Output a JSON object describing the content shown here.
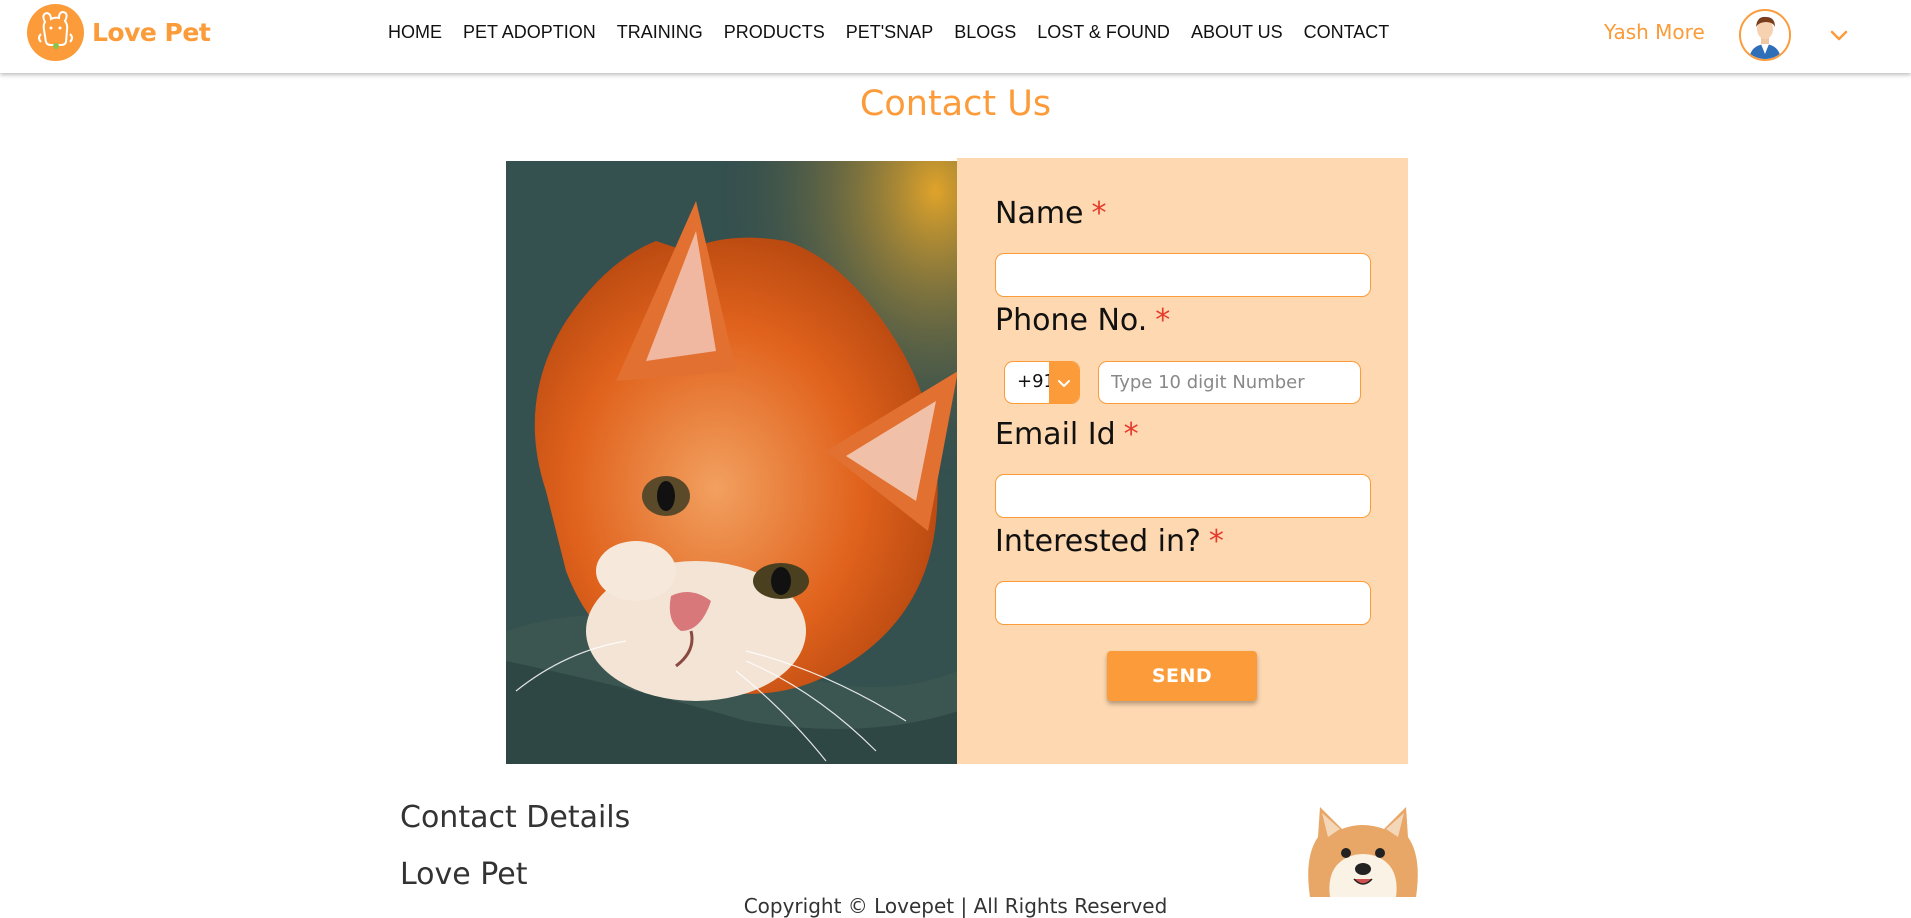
{
  "brand": {
    "name": "Love Pet"
  },
  "nav": {
    "items": [
      {
        "label": "HOME"
      },
      {
        "label": "PET ADOPTION"
      },
      {
        "label": "TRAINING"
      },
      {
        "label": "PRODUCTS"
      },
      {
        "label": "PET'SNAP"
      },
      {
        "label": "BLOGS"
      },
      {
        "label": "LOST & FOUND"
      },
      {
        "label": "ABOUT US"
      },
      {
        "label": "CONTACT"
      }
    ]
  },
  "user": {
    "name": "Yash More"
  },
  "page": {
    "title": "Contact Us"
  },
  "form": {
    "name_label": "Name",
    "name_value": "",
    "phone_label": "Phone No.",
    "country_code": "+91",
    "phone_placeholder": "Type 10 digit Number",
    "email_label": "Email Id",
    "email_value": "",
    "interest_label": "Interested in?",
    "interest_value": "",
    "required_mark": "*",
    "send_label": "SEND"
  },
  "footer": {
    "contact_details": "Contact Details",
    "brand": "Love Pet",
    "copyright": "Copyright © Lovepet | All Rights Reserved"
  },
  "colors": {
    "accent": "#fb9b3a",
    "panel": "#fed8b0",
    "required": "#e53b2c"
  }
}
